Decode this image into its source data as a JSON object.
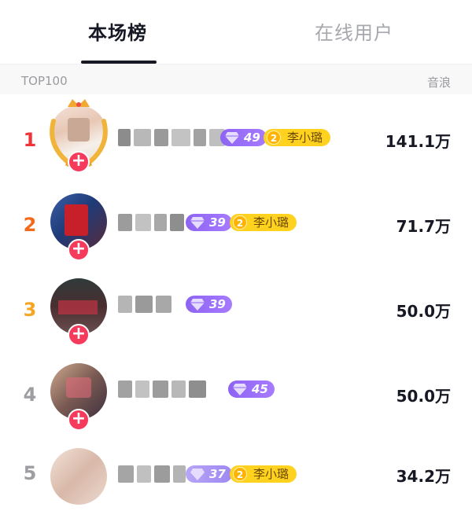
{
  "tabs": [
    {
      "label": "本场榜",
      "active": true
    },
    {
      "label": "在线用户",
      "active": false
    }
  ],
  "list_header": {
    "left": "TOP100",
    "right": "音浪"
  },
  "colors": {
    "rank1": "#f0343a",
    "rank2": "#f26a1b",
    "rank3": "#f5a623",
    "rank_other": "#9d9da2",
    "accent_pink": "#f63a5b",
    "level_purple": "#8d63f2",
    "fan_gold": "#ffd21f"
  },
  "rows": [
    {
      "rank": "1",
      "level": "49",
      "fan_club": {
        "level": "2",
        "name": "李小璐"
      },
      "value": "141.1万"
    },
    {
      "rank": "2",
      "level": "39",
      "fan_club": {
        "level": "2",
        "name": "李小璐"
      },
      "value": "71.7万"
    },
    {
      "rank": "3",
      "level": "39",
      "value": "50.0万"
    },
    {
      "rank": "4",
      "level": "45",
      "value": "50.0万"
    },
    {
      "rank": "5",
      "level": "37",
      "fan_club": {
        "level": "2",
        "name": "李小璐"
      },
      "value": "34.2万"
    }
  ],
  "icons": {
    "follow": "plus-icon",
    "level": "gem-icon",
    "crown": "laurel-crown-icon"
  }
}
